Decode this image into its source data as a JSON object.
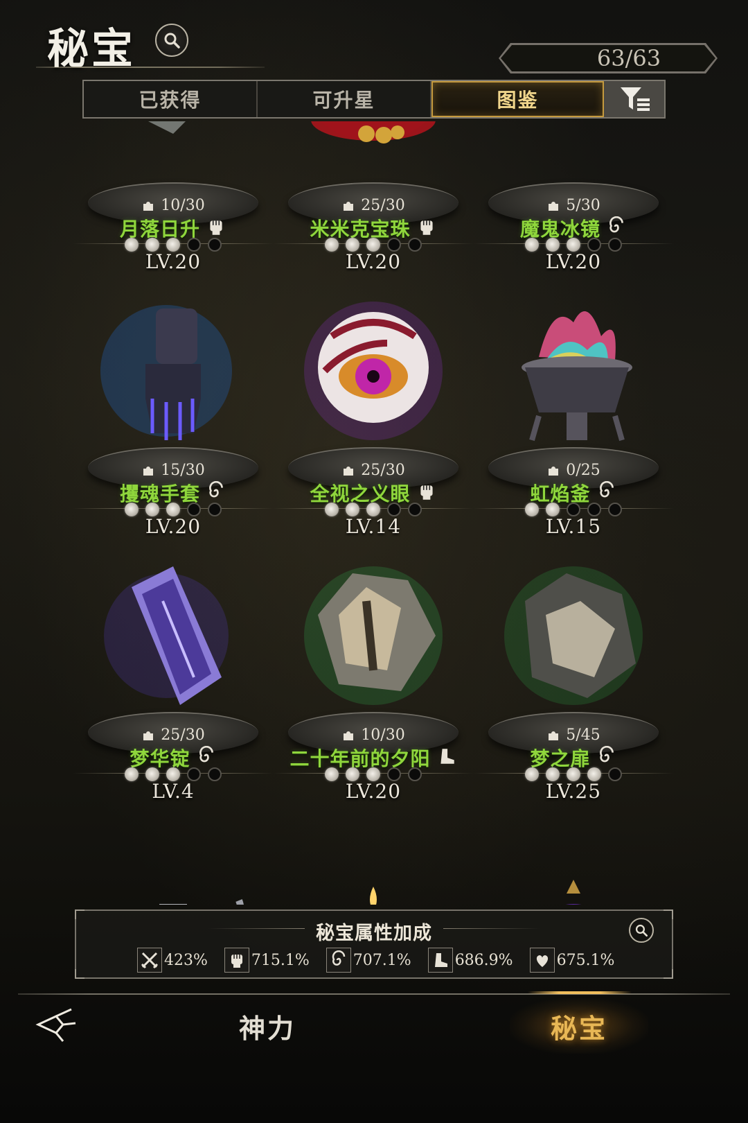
{
  "header": {
    "title": "秘宝",
    "counter": "63/63"
  },
  "tabs": [
    {
      "label": "已获得",
      "active": false
    },
    {
      "label": "可升星",
      "active": false
    },
    {
      "label": "图鉴",
      "active": true
    }
  ],
  "items": [
    {
      "name": "月落日升",
      "fragments": "10/30",
      "stars": 3,
      "max_stars": 5,
      "level": "LV.20",
      "type_icon": "fist-icon",
      "art_icon": "shard-relic-icon"
    },
    {
      "name": "米米克宝珠",
      "fragments": "25/30",
      "stars": 3,
      "max_stars": 5,
      "level": "LV.20",
      "type_icon": "fist-icon",
      "art_icon": "mimic-orb-icon"
    },
    {
      "name": "魔鬼冰镜",
      "fragments": "5/30",
      "stars": 3,
      "max_stars": 5,
      "level": "LV.20",
      "type_icon": "swirl-icon",
      "art_icon": "ice-mirror-icon"
    },
    {
      "name": "攫魂手套",
      "fragments": "15/30",
      "stars": 3,
      "max_stars": 5,
      "level": "LV.20",
      "type_icon": "swirl-icon",
      "art_icon": "gauntlet-icon"
    },
    {
      "name": "全视之义眼",
      "fragments": "25/30",
      "stars": 3,
      "max_stars": 5,
      "level": "LV.14",
      "type_icon": "fist-icon",
      "art_icon": "eye-orb-icon"
    },
    {
      "name": "虹焰釜",
      "fragments": "0/25",
      "stars": 2,
      "max_stars": 5,
      "level": "LV.15",
      "type_icon": "swirl-icon",
      "art_icon": "flame-cauldron-icon"
    },
    {
      "name": "梦华锭",
      "fragments": "25/30",
      "stars": 3,
      "max_stars": 5,
      "level": "LV.4",
      "type_icon": "swirl-icon",
      "art_icon": "crystal-ingot-icon"
    },
    {
      "name": "二十年前的夕阳",
      "fragments": "10/30",
      "stars": 3,
      "max_stars": 5,
      "level": "LV.20",
      "type_icon": "boot-icon",
      "art_icon": "shattered-portrait-icon"
    },
    {
      "name": "梦之扉",
      "fragments": "5/45",
      "stars": 4,
      "max_stars": 5,
      "level": "LV.25",
      "type_icon": "swirl-icon",
      "art_icon": "dream-door-icon"
    },
    {
      "art_icon": "teapot-icon"
    },
    {
      "art_icon": "candle-icon"
    },
    {
      "art_icon": "lantern-icon"
    }
  ],
  "bonus": {
    "title": "秘宝属性加成",
    "stats": [
      {
        "icon": "crossed-swords-icon",
        "value": "423%"
      },
      {
        "icon": "fist-icon",
        "value": "715.1%"
      },
      {
        "icon": "swirl-icon",
        "value": "707.1%"
      },
      {
        "icon": "boot-icon",
        "value": "686.9%"
      },
      {
        "icon": "heart-hand-icon",
        "value": "675.1%"
      }
    ]
  },
  "nav": {
    "divine_power": "神力",
    "treasure": "秘宝"
  },
  "colors": {
    "name_green": "#8fd63c",
    "active_gold": "#e8b755",
    "tab_gold": "#c59a3e"
  }
}
